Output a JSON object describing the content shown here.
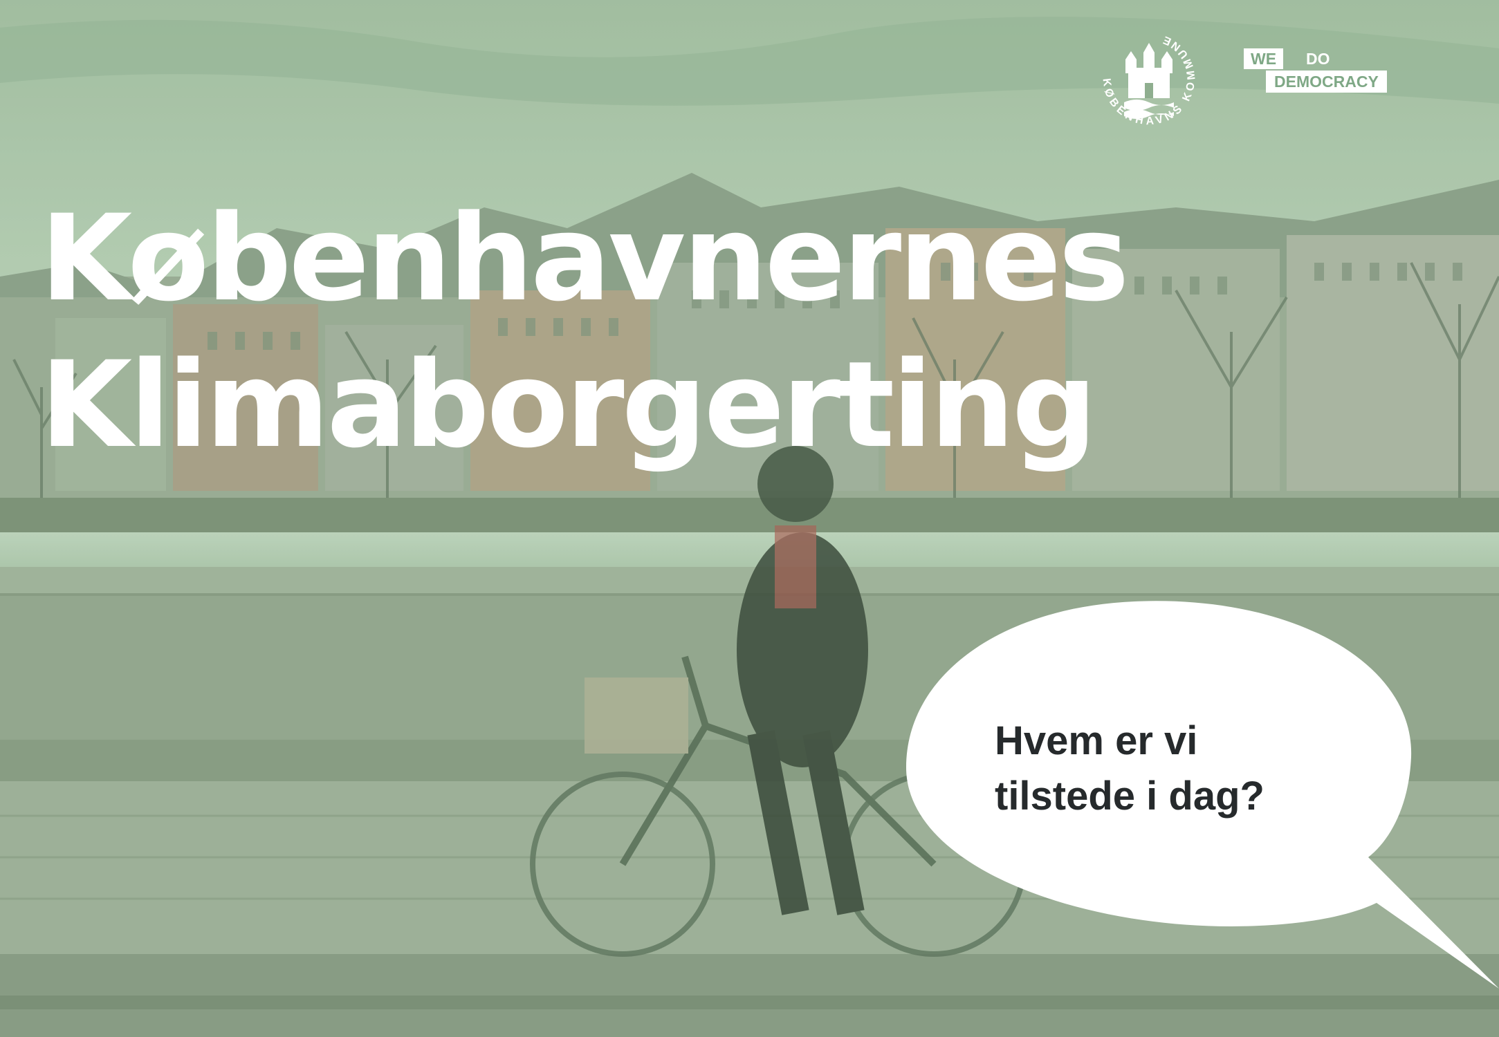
{
  "slide": {
    "title_line1": "Københavnernes",
    "title_line2": "Klimaborgerting",
    "bubble_line1": "Hvem er vi",
    "bubble_line2": "tilstede i dag?"
  },
  "logos": {
    "kk_text": "KØBENHAVNS KOMMUNE",
    "wdd_we": "WE",
    "wdd_do": "DO",
    "wdd_democracy": "DEMOCRACY"
  },
  "colors": {
    "tint": "#8fae8f",
    "title": "#ffffff",
    "bubble": "#ffffff",
    "bubble_text": "#262a2c"
  },
  "icons": [
    "copenhagen-coat-of-arms-icon",
    "we-do-democracy-logo-icon"
  ]
}
